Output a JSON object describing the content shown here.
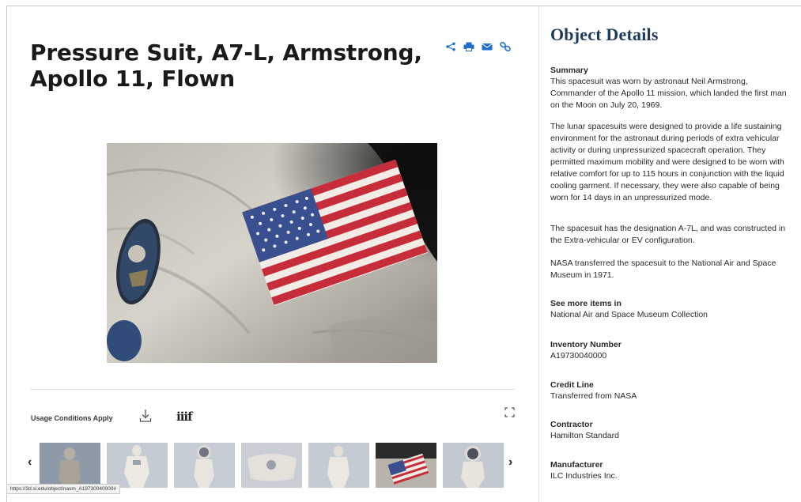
{
  "object": {
    "title_line1": "Pressure Suit, A7-L, Armstrong,",
    "title_line2": "Apollo 11, Flown"
  },
  "share_tools": [
    {
      "icon": "share-icon"
    },
    {
      "icon": "print-icon"
    },
    {
      "icon": "email-icon"
    },
    {
      "icon": "link-icon"
    }
  ],
  "media_bar": {
    "usage_label": "Usage Conditions Apply",
    "download_icon": "download-icon",
    "iiif_label": "iiif",
    "expand_icon": "expand-icon"
  },
  "carousel": {
    "prev_label": "‹",
    "next_label": "›",
    "thumbnails": [
      "suit-front-dark",
      "suit-front",
      "suit-front-helmet",
      "suit-torso-top",
      "suit-front-full",
      "flag-patch",
      "suit-helmet"
    ]
  },
  "status_bar": {
    "url": "https://3d.si.edu/object/nasm_A19730040000#"
  },
  "details": {
    "heading": "Object Details",
    "summary_label": "Summary",
    "summary_p1_l1": "This spacesuit was worn by astronaut Neil Armstrong,",
    "summary_p1_l2": "Commander of the Apollo 11 mission, which landed the first man",
    "summary_p1_l3": "on the Moon on July 20, 1969.",
    "summary_p2_l1": "The lunar spacesuits were designed to provide a life sustaining",
    "summary_p2_l2": "environment for the astronaut during periods of extra vehicular",
    "summary_p2_l3": "activity or during unpressurized spacecraft operation. They",
    "summary_p2_l4": "permitted maximum mobility and were designed to be worn with",
    "summary_p2_l5": "relative comfort for up to 115 hours in conjunction with the liquid",
    "summary_p2_l6": "cooling garment. If necessary, they were also capable of being",
    "summary_p2_l7": "worn for 14 days in an unpressurized mode.",
    "summary_p3_l1": "The spacesuit has the designation A-7L, and was constructed in",
    "summary_p3_l2": "the Extra-vehicular or EV configuration.",
    "summary_p4_l1": "NASA transferred the spacesuit to the National Air and Space",
    "summary_p4_l2": "Museum in 1971.",
    "see_more_label": "See more items in",
    "see_more_value": "National Air and Space Museum Collection",
    "inventory_label": "Inventory Number",
    "inventory_value": "A19730040000",
    "credit_label": "Credit Line",
    "credit_value": "Transferred from NASA",
    "contractor_label": "Contractor",
    "contractor_value": "Hamilton Standard",
    "manufacturer_label": "Manufacturer",
    "manufacturer_value": "ILC Industries Inc."
  },
  "colors": {
    "accent_blue": "#1f6fd0",
    "heading_navy": "#1d3a5c"
  }
}
